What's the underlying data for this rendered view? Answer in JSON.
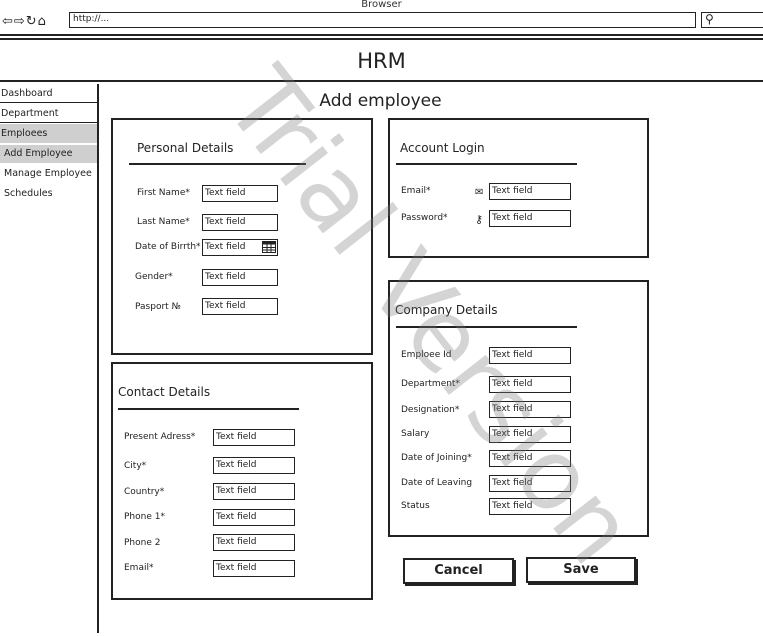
{
  "browser": {
    "window_title": "Browser",
    "url": "http://...",
    "nav_icons": "⇦⇨↻⌂",
    "search_icon": "⚲"
  },
  "app": {
    "title": "HRM"
  },
  "sidebar": {
    "items": [
      {
        "label": "Dashboard"
      },
      {
        "label": "Department"
      },
      {
        "label": "Emploees"
      }
    ],
    "sub_items": [
      {
        "label": "Add Employee",
        "active": true
      },
      {
        "label": "Manage Employee"
      },
      {
        "label": "Schedules"
      }
    ]
  },
  "page": {
    "heading": "Add employee"
  },
  "personal": {
    "title": "Personal Details",
    "fields": [
      {
        "label": "First Name*",
        "value": "Text field"
      },
      {
        "label": "Last Name*",
        "value": "Text field"
      },
      {
        "label": "Date of Birrth*",
        "value": "Text field"
      },
      {
        "label": "Gender*",
        "value": "Text field"
      },
      {
        "label": "Pasport №",
        "value": "Text field"
      }
    ]
  },
  "contact": {
    "title": "Contact Details",
    "fields": [
      {
        "label": "Present Adress*",
        "value": "Text field"
      },
      {
        "label": "City*",
        "value": "Text field"
      },
      {
        "label": "Country*",
        "value": "Text field"
      },
      {
        "label": "Phone 1*",
        "value": "Text field"
      },
      {
        "label": "Phone 2",
        "value": "Text field"
      },
      {
        "label": "Email*",
        "value": "Text field"
      }
    ]
  },
  "account": {
    "title": "Account Login",
    "fields": [
      {
        "label": "Email*",
        "value": "Text field",
        "icon": "mail-icon"
      },
      {
        "label": "Password*",
        "value": "Text field",
        "icon": "key-icon"
      }
    ]
  },
  "company": {
    "title": "Company Details",
    "fields": [
      {
        "label": "Emploee Id",
        "value": "Text field"
      },
      {
        "label": "Department*",
        "value": "Text field"
      },
      {
        "label": "Designation*",
        "value": "Text field"
      },
      {
        "label": "Salary",
        "value": "Text field"
      },
      {
        "label": "Date of Joining*",
        "value": "Text field"
      },
      {
        "label": "Date of Leaving",
        "value": "Text field"
      },
      {
        "label": "Status",
        "value": "Text field"
      }
    ]
  },
  "actions": {
    "cancel_label": "Cancel",
    "save_label": "Save"
  },
  "watermark": {
    "text": "Trial Version"
  }
}
